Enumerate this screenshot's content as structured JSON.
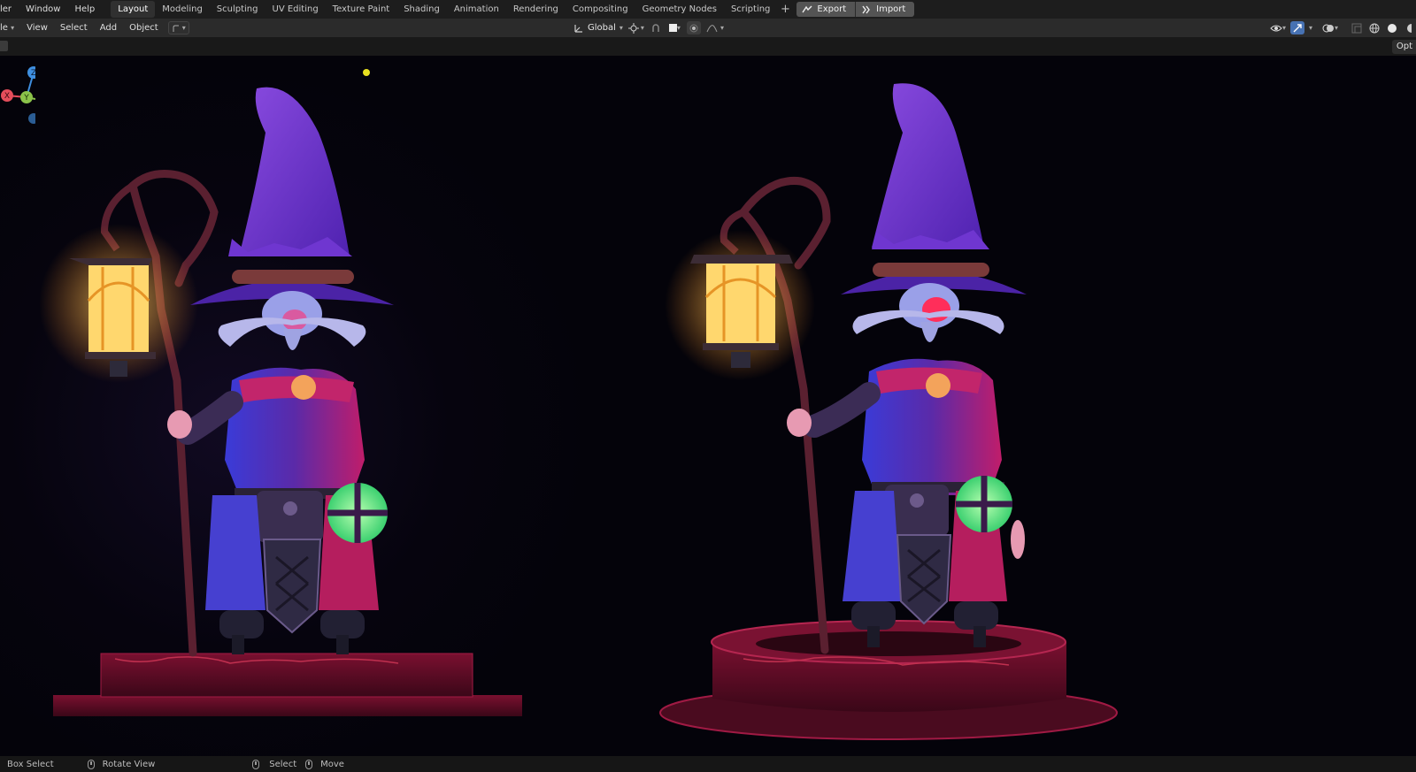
{
  "menu": [
    "ler",
    "Window",
    "Help"
  ],
  "workspace_tabs": [
    "Layout",
    "Modeling",
    "Sculpting",
    "UV Editing",
    "Texture Paint",
    "Shading",
    "Animation",
    "Rendering",
    "Compositing",
    "Geometry Nodes",
    "Scripting"
  ],
  "active_tab": "Layout",
  "addon": {
    "export": "Export",
    "import": "Import"
  },
  "header": {
    "mode_fragment": "le",
    "menus": [
      "View",
      "Select",
      "Add",
      "Object"
    ],
    "transform_orientation": "Global"
  },
  "toolbar": {
    "options_label": "Opt"
  },
  "gizmo": {
    "x": "X",
    "y": "Y",
    "z": "Z"
  },
  "status": {
    "box_select": "Box Select",
    "rotate_view": "Rotate View",
    "select": "Select",
    "move": "Move"
  },
  "colors": {
    "accent": "#4772b3",
    "topbar": "#1d1d1d",
    "header": "#2b2b2b",
    "viewport_bg": "#05030c",
    "gizmo_x": "#e44d5b",
    "gizmo_y": "#8bc34a",
    "gizmo_z": "#3f8fe0"
  }
}
